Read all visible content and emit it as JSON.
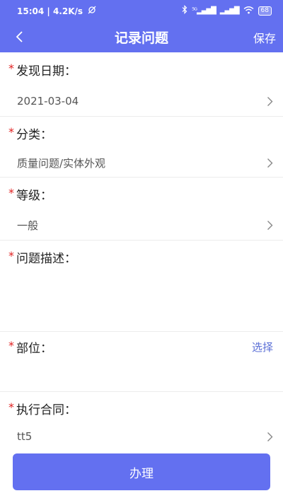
{
  "status_bar": {
    "time": "15:04",
    "speed": "4.2K/s",
    "signal_1": "⁵ᴳ▂▄▆█",
    "signal_2": "▂▄▆█",
    "battery": "68"
  },
  "nav": {
    "title": "记录问题",
    "save_label": "保存"
  },
  "form": {
    "date": {
      "label": "发现日期：",
      "value": "2021-03-04"
    },
    "category": {
      "label": "分类：",
      "value": "质量问题/实体外观"
    },
    "level": {
      "label": "等级：",
      "value": "一般"
    },
    "description": {
      "label": "问题描述：",
      "value": ""
    },
    "location": {
      "label": "部位：",
      "select_label": "选择"
    },
    "contract": {
      "label": "执行合同：",
      "value": "tt5"
    }
  },
  "submit_label": "办理"
}
